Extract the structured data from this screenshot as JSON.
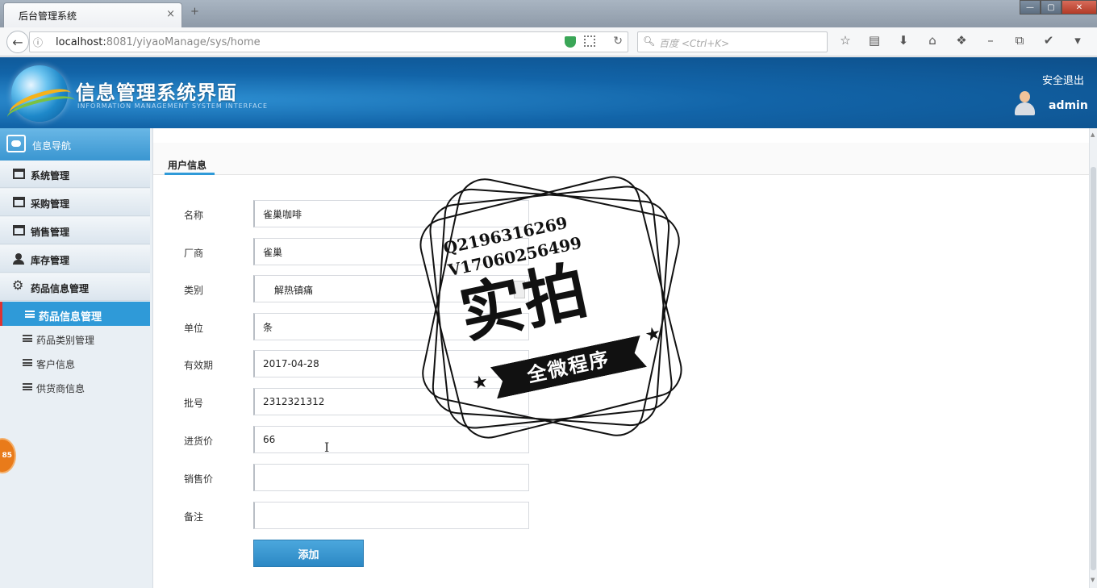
{
  "browser": {
    "tab_title": "后台管理系统",
    "tab_close": "×",
    "new_tab": "+",
    "url_host": "localhost:",
    "url_path": "8081/yiyaoManage/sys/home",
    "search_placeholder": "百度 <Ctrl+K>",
    "window_buttons": [
      "—",
      "▢",
      "✕"
    ]
  },
  "header": {
    "app_title": "信息管理系统界面",
    "app_subtitle": "INFORMATION MANAGEMENT SYSTEM INTERFACE",
    "logout": "安全退出",
    "username": "admin"
  },
  "sidebar": {
    "head_label": "信息导航",
    "groups": [
      {
        "label": "系统管理",
        "icon": "calendar-icon"
      },
      {
        "label": "采购管理",
        "icon": "calendar-icon"
      },
      {
        "label": "销售管理",
        "icon": "calendar-icon"
      },
      {
        "label": "库存管理",
        "icon": "user-icon"
      },
      {
        "label": "药品信息管理",
        "icon": "gear-icon"
      }
    ],
    "sub_items": [
      {
        "label": "药品信息管理",
        "active": true
      },
      {
        "label": "药品类别管理",
        "active": false
      },
      {
        "label": "客户信息",
        "active": false
      },
      {
        "label": "供货商信息",
        "active": false
      }
    ],
    "float_badge": "85"
  },
  "main": {
    "tab_label": "用户信息",
    "form": {
      "name_label": "名称",
      "name_value": "雀巢咖啡",
      "vendor_label": "厂商",
      "vendor_value": "雀巢",
      "category_label": "类别",
      "category_value": "解热镇痛",
      "unit_label": "单位",
      "unit_value": "条",
      "expiry_label": "有效期",
      "expiry_value": "2017-04-28",
      "batch_label": "批号",
      "batch_value": "2312321312",
      "purchase_price_label": "进货价",
      "purchase_price_value": "66",
      "sale_price_label": "销售价",
      "sale_price_value": "",
      "remark_label": "备注",
      "remark_value": "",
      "submit_label": "添加"
    }
  },
  "watermark": {
    "qq": "Q2196316269",
    "vx": "V17060256499",
    "big": "实拍",
    "banner": "全微程序"
  }
}
